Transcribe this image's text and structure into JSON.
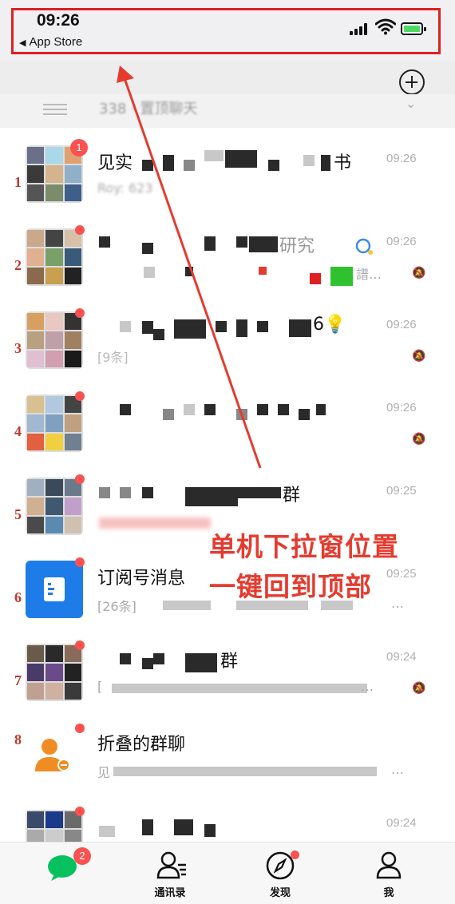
{
  "status_bar": {
    "time": "09:26",
    "back_label": "App Store",
    "back_arrow": "◀"
  },
  "filter_row": {
    "text": "338 · 置顶聊天",
    "chevron": "⌄"
  },
  "chats": [
    {
      "rank": "1",
      "title": "见实",
      "title_suffix": "书",
      "preview": "Roy: 623",
      "time": "09:26",
      "badge": "1",
      "muted": false
    },
    {
      "rank": "2",
      "title": "",
      "title_suffix": "研究",
      "preview": "",
      "time": "09:26",
      "badge": "",
      "muted": true
    },
    {
      "rank": "3",
      "title": "",
      "title_suffix": "6💡",
      "preview": "[9条]",
      "time": "09:26",
      "badge": "",
      "muted": true
    },
    {
      "rank": "4",
      "title": "",
      "title_suffix": "",
      "preview": "",
      "time": "09:26",
      "badge": "",
      "muted": true
    },
    {
      "rank": "5",
      "title": "",
      "title_suffix": "群",
      "preview": "",
      "time": "09:25",
      "badge": "",
      "muted": true
    },
    {
      "rank": "6",
      "title": "订阅号消息",
      "title_suffix": "",
      "preview": "[26条]",
      "time": "09:25",
      "badge": "",
      "muted": false
    },
    {
      "rank": "7",
      "title": "",
      "title_suffix": "群",
      "preview": "[",
      "time": "09:24",
      "badge": "",
      "muted": true
    },
    {
      "rank": "8",
      "title": "折叠的群聊",
      "title_suffix": "",
      "preview": "见",
      "time": "",
      "badge": "",
      "muted": false
    },
    {
      "rank": "",
      "title": "",
      "title_suffix": "",
      "preview": "",
      "time": "09:24",
      "badge": "",
      "muted": false
    }
  ],
  "annotation": {
    "line1": "单机下拉窗位置",
    "line2": "一键回到顶部",
    "color": "#e53b2f"
  },
  "tab_bar": {
    "tabs": [
      {
        "label": "",
        "badge": "2"
      },
      {
        "label": "通讯录",
        "badge": ""
      },
      {
        "label": "发现",
        "badge": ""
      },
      {
        "label": "我",
        "badge": ""
      }
    ]
  },
  "colors": {
    "badge": "#fa5151",
    "wechat_green": "#07c160",
    "highlight_box": "#e02020"
  }
}
